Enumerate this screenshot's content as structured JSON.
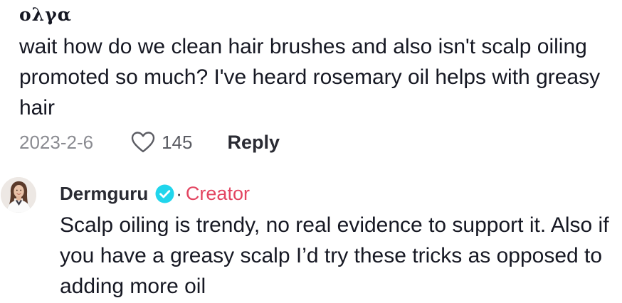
{
  "comment": {
    "username": "ολγα",
    "text": "wait how do we clean hair brushes and also isn't scalp oiling promoted so much? I've heard rosemary oil helps with greasy hair",
    "date": "2023-2-6",
    "like_count": "145",
    "like_icon": "heart-outline-icon",
    "reply_label": "Reply"
  },
  "reply": {
    "username": "Dermguru",
    "verified_icon": "verified-check-icon",
    "separator": "·",
    "badge": "Creator",
    "badge_color": "#e34561",
    "text": "Scalp oiling is trendy, no real evidence to support it. Also if you have a greasy scalp I’d try these tricks as opposed to adding more oil"
  },
  "colors": {
    "text": "#161823",
    "muted": "#8a8b91",
    "verified": "#20d5ec"
  }
}
